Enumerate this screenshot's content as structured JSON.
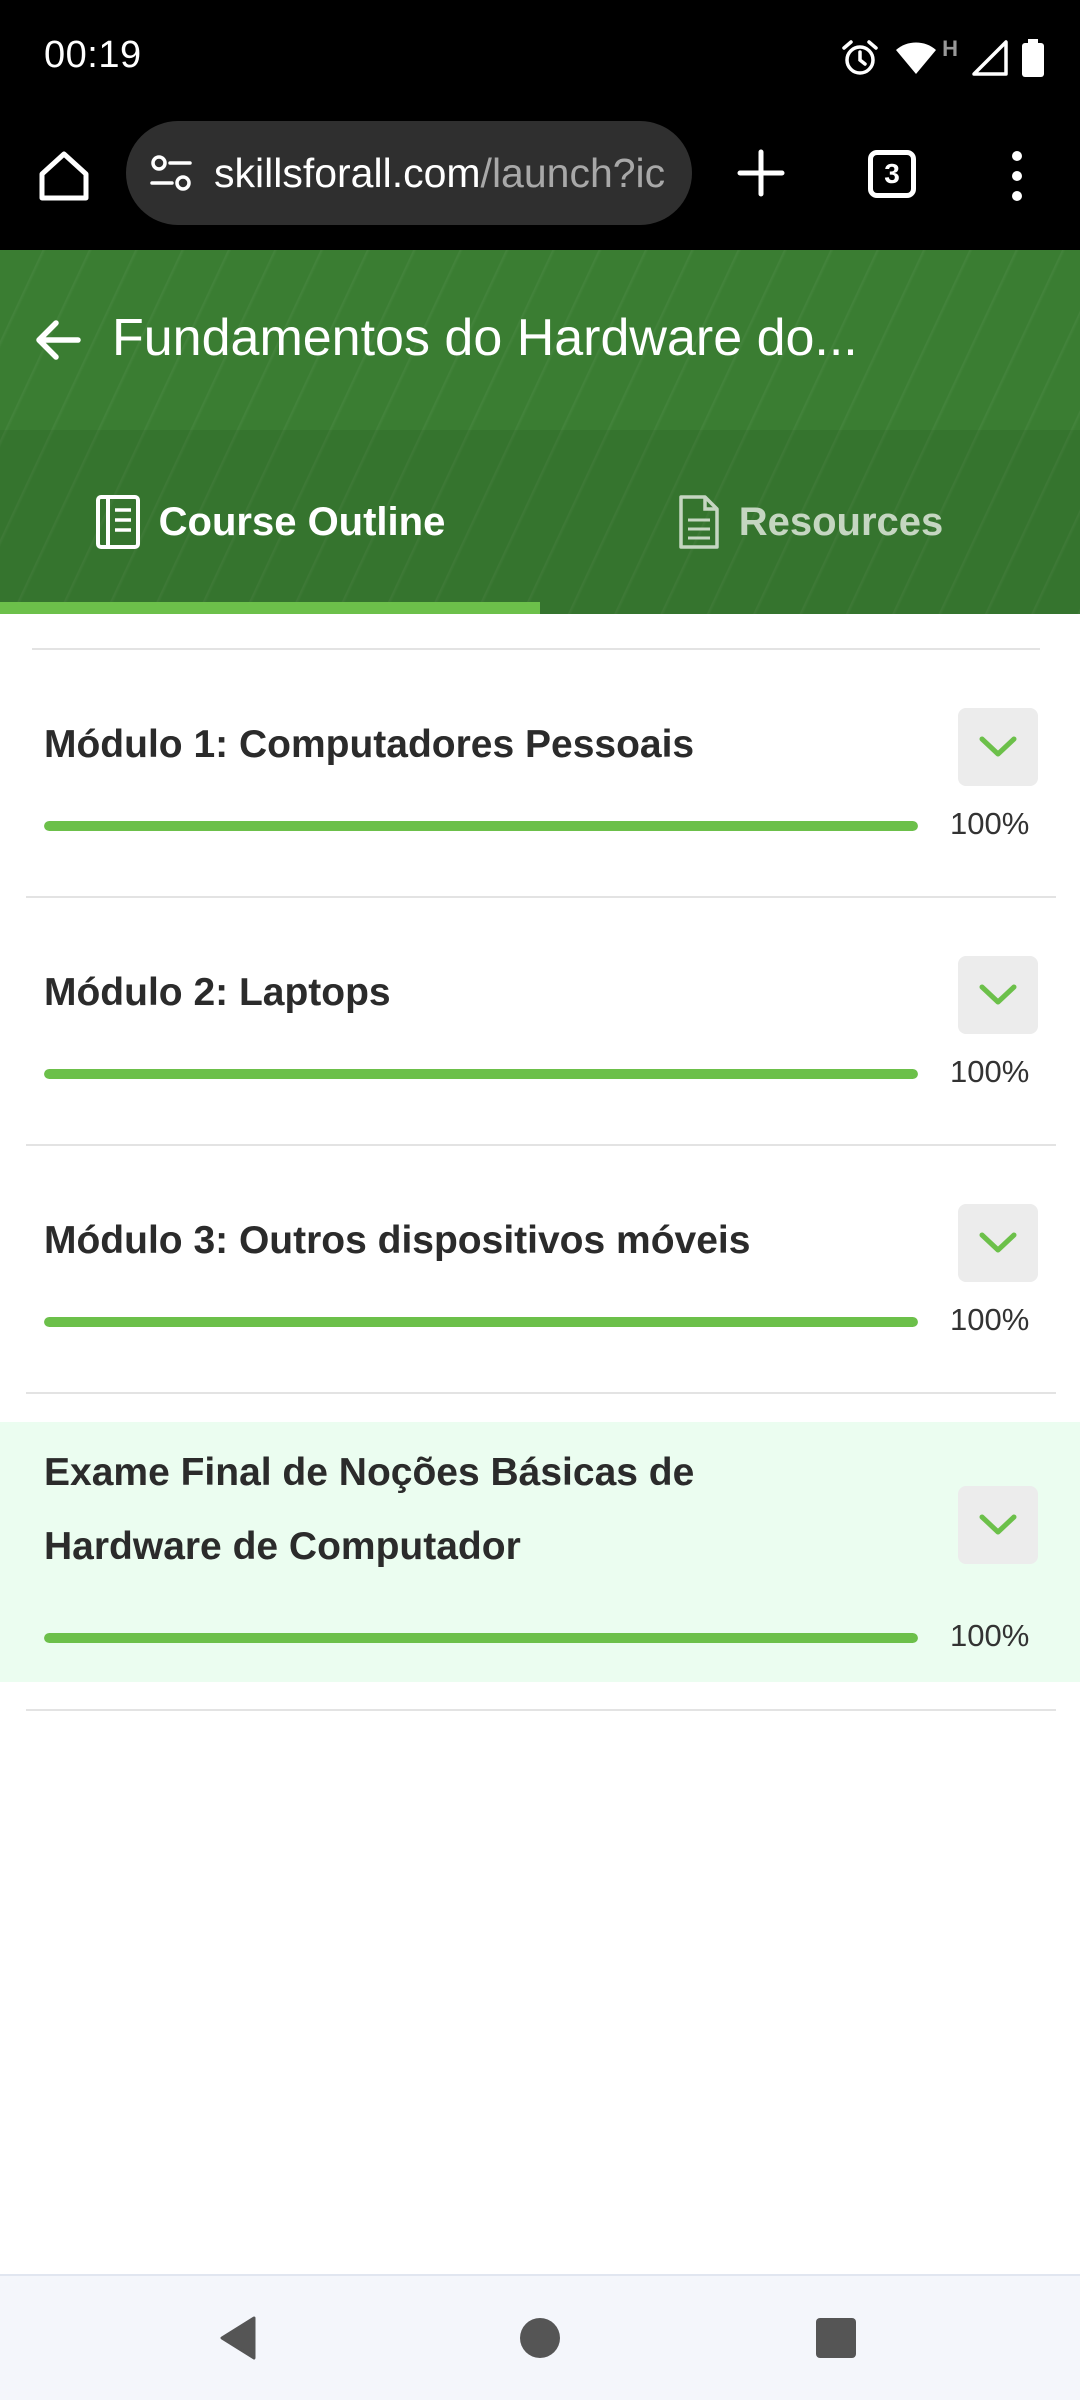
{
  "status_bar": {
    "time": "00:19",
    "icons": [
      "alarm-icon",
      "wifi-icon",
      "signal-icon",
      "battery-icon"
    ],
    "network_label": "H"
  },
  "browser": {
    "url_host": "skillsforall.com",
    "url_path": "/launch?ic",
    "tab_count": "3"
  },
  "course": {
    "title": "Fundamentos do Hardware do...",
    "tabs": [
      {
        "label": "Course Outline",
        "active": true
      },
      {
        "label": "Resources",
        "active": false
      }
    ]
  },
  "modules": [
    {
      "title": "Módulo 1: Computadores Pessoais",
      "progress_label": "100%",
      "progress": 1.0
    },
    {
      "title": "Módulo 2: Laptops",
      "progress_label": "100%",
      "progress": 1.0
    },
    {
      "title": "Módulo 3: Outros dispositivos móveis",
      "progress_label": "100%",
      "progress": 1.0
    },
    {
      "title": "Exame Final de Noções Básicas de Hardware de Computador",
      "progress_label": "100%",
      "progress": 1.0
    }
  ],
  "colors": {
    "header_green": "#3a7d32",
    "accent_green": "#6cc04a",
    "final_highlight": "#ebfdf0"
  }
}
